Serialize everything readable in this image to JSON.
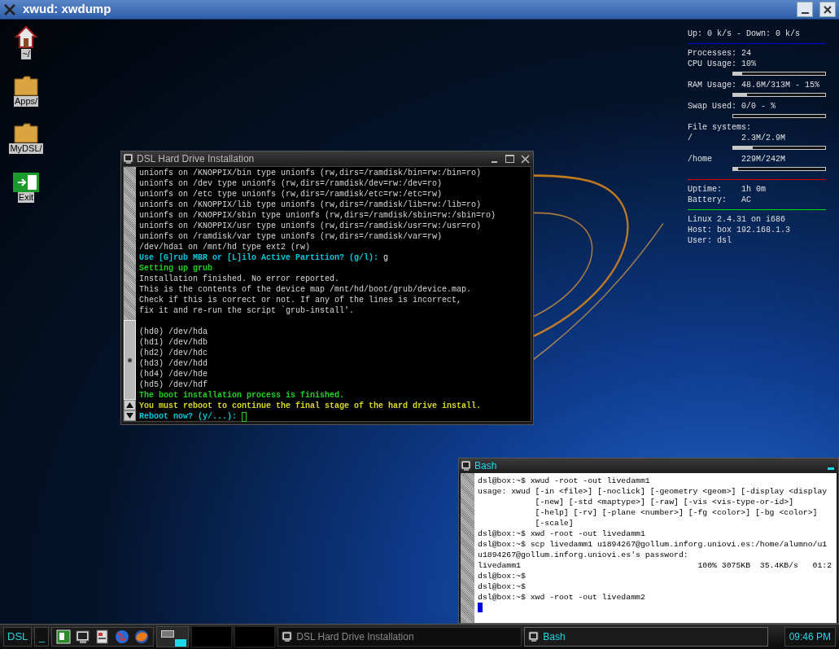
{
  "window": {
    "title": "xwud: xwdump"
  },
  "desktop_icons": [
    {
      "label": "~/",
      "kind": "home"
    },
    {
      "label": "Apps/",
      "kind": "folder"
    },
    {
      "label": "MyDSL/",
      "kind": "folder"
    },
    {
      "label": "Exit",
      "kind": "exit"
    }
  ],
  "system_monitor": {
    "items": [
      {
        "kind": "line",
        "label": "Up: 0 k/s - Down: 0 k/s"
      },
      {
        "kind": "rule",
        "color": "#0000e0"
      },
      {
        "kind": "line",
        "label": "Processes:",
        "value": "24"
      },
      {
        "kind": "line",
        "label": "CPU Usage:",
        "value": "10%"
      },
      {
        "kind": "bar",
        "level": 0.1
      },
      {
        "kind": "line",
        "label": "RAM Usage:",
        "value": "48.6M/313M - 15%"
      },
      {
        "kind": "bar",
        "level": 0.15
      },
      {
        "kind": "line",
        "label": "Swap Used:",
        "value": "0/0 - %"
      },
      {
        "kind": "bar",
        "level": 0
      },
      {
        "kind": "line",
        "label": "File systems:"
      },
      {
        "kind": "line",
        "label": "/",
        "value": "2.3M/2.9M"
      },
      {
        "kind": "bar",
        "level": 0.21
      },
      {
        "kind": "line",
        "label": "/home",
        "value": "229M/242M"
      },
      {
        "kind": "bar",
        "level": 0.05
      },
      {
        "kind": "rule",
        "color": "#e00000"
      },
      {
        "kind": "line",
        "label": "Uptime:",
        "value": "1h 0m"
      },
      {
        "kind": "line",
        "label": "Battery:",
        "value": "AC"
      },
      {
        "kind": "rule",
        "color": "#00e000"
      },
      {
        "kind": "line",
        "label": "Linux 2.4.31 on i686"
      },
      {
        "kind": "line",
        "label": "Host: box 192.168.1.3"
      },
      {
        "kind": "line",
        "label": "User: dsl"
      }
    ]
  },
  "install_window": {
    "title": "DSL Hard Drive Installation",
    "lines": [
      {
        "kind": "output",
        "text": "unionfs on /KNOPPIX/bin type unionfs (rw,dirs=/ramdisk/bin=rw:/bin=ro)"
      },
      {
        "kind": "output",
        "text": "unionfs on /dev type unionfs (rw,dirs=/ramdisk/dev=rw:/dev=ro)"
      },
      {
        "kind": "output",
        "text": "unionfs on /etc type unionfs (rw,dirs=/ramdisk/etc=rw:/etc=rw)"
      },
      {
        "kind": "output",
        "text": "unionfs on /KNOPPIX/lib type unionfs (rw,dirs=/ramdisk/lib=rw:/lib=ro)"
      },
      {
        "kind": "output",
        "text": "unionfs on /KNOPPIX/sbin type unionfs (rw,dirs=/ramdisk/sbin=rw:/sbin=ro)"
      },
      {
        "kind": "output",
        "text": "unionfs on /KNOPPIX/usr type unionfs (rw,dirs=/ramdisk/usr=rw:/usr=ro)"
      },
      {
        "kind": "output",
        "text": "unionfs on /ramdisk/var type unionfs (rw,dirs=/ramdisk/var=rw)"
      },
      {
        "kind": "output",
        "text": "/dev/hda1 on /mnt/hd type ext2 (rw)"
      },
      {
        "kind": "prompt",
        "text": "Use [G]rub MBR or [L]ilo Active Partition? (g/l):",
        "answer": "g"
      },
      {
        "kind": "success",
        "text": "Setting up grub"
      },
      {
        "kind": "output",
        "text": "Installation finished. No error reported."
      },
      {
        "kind": "output",
        "text": "This is the contents of the device map /mnt/hd/boot/grub/device.map."
      },
      {
        "kind": "output",
        "text": "Check if this is correct or not. If any of the lines is incorrect,"
      },
      {
        "kind": "output",
        "text": "fix it and re-run the script `grub-install'."
      },
      {
        "kind": "blank"
      },
      {
        "kind": "output",
        "text": "(hd0) /dev/hda"
      },
      {
        "kind": "output",
        "text": "(hd1) /dev/hdb"
      },
      {
        "kind": "output",
        "text": "(hd2) /dev/hdc"
      },
      {
        "kind": "output",
        "text": "(hd3) /dev/hdd"
      },
      {
        "kind": "output",
        "text": "(hd4) /dev/hde"
      },
      {
        "kind": "output",
        "text": "(hd5) /dev/hdf"
      },
      {
        "kind": "success",
        "text": "The boot installation process is finished."
      },
      {
        "kind": "warning",
        "text": "You must reboot to continue the final stage of the hard drive install."
      },
      {
        "kind": "prompt",
        "text": "Reboot now? (y/...):",
        "cursor": true
      }
    ]
  },
  "bash_window": {
    "title": "Bash",
    "cursor": true,
    "lines": [
      "dsl@box:~$ xwud -root -out livedamm1",
      "usage: xwud [-in <file>] [-noclick] [-geometry <geom>] [-display <display",
      "            [-new] [-std <maptype>] [-raw] [-vis <vis-type-or-id>]",
      "            [-help] [-rv] [-plane <number>] [-fg <color>] [-bg <color>]",
      "            [-scale]",
      "dsl@box:~$ xwd -root -out livedamm1",
      "dsl@box:~$ scp livedamm1 u1894267@gollum.inforg.uniovi.es:/home/alumno/u1",
      "u1894267@gollum.inforg.uniovi.es's password:",
      "livedamm1                                     100% 3075KB  35.4KB/s   01:2",
      "dsl@box:~$",
      "dsl@box:~$",
      "dsl@box:~$ xwd -root -out livedamm2"
    ]
  },
  "taskbar": {
    "start": "DSL",
    "minimize": "_",
    "tasks": [
      {
        "label": "DSL Hard Drive Installation",
        "selected": false
      },
      {
        "label": "Bash",
        "selected": true
      }
    ],
    "clock": "09:46 PM"
  }
}
